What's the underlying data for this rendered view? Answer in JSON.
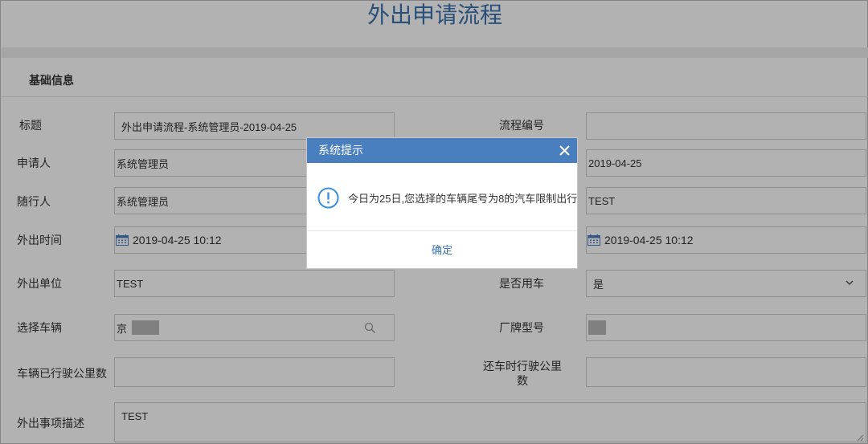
{
  "page": {
    "title": "外出申请流程"
  },
  "section": {
    "title": "基础信息"
  },
  "form": {
    "title_label": "标题",
    "title_value": "外出申请流程-系统管理员-2019-04-25",
    "flow_no_label": "流程编号",
    "flow_no_value": "",
    "applicant_label": "申请人",
    "applicant_value": "系统管理员",
    "apply_date_value": "2019-04-25",
    "companion_label": "随行人",
    "companion_value": "系统管理员",
    "companion_right_value": "TEST",
    "out_time_label": "外出时间",
    "out_time_value": "2019-04-25 10:12",
    "return_time_value": "2019-04-25 10:12",
    "out_unit_label": "外出单位",
    "out_unit_value": "TEST",
    "use_car_label": "是否用车",
    "use_car_value": "是",
    "vehicle_label": "选择车辆",
    "vehicle_value": "京",
    "brand_label": "厂牌型号",
    "brand_value": "",
    "mileage_label": "车辆已行驶公里数",
    "mileage_value": "",
    "return_mileage_label_1": "还车时行驶公里",
    "return_mileage_label_2": "数",
    "return_mileage_value": "",
    "desc_label": "外出事项描述",
    "desc_value": "TEST"
  },
  "dialog": {
    "title": "系统提示",
    "message": "今日为25日,您选择的车辆尾号为8的汽车限制出行",
    "ok_label": "确定"
  },
  "icons": {
    "calendar": "calendar-icon",
    "search": "search-icon",
    "chevron": "chevron-down-icon",
    "close": "close-icon",
    "warning": "exclamation-circle-icon"
  },
  "colors": {
    "accent": "#4a7fbf",
    "title": "#3b73b0"
  }
}
